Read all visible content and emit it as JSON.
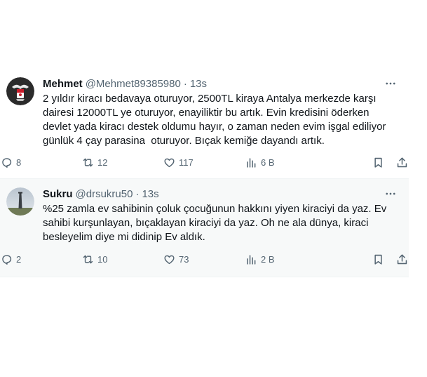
{
  "tweets": [
    {
      "name": "Mehmet",
      "handle": "@Mehmet89385980",
      "separator": "·",
      "time": "13s",
      "text": "2 yıldır kiracı bedavaya oturuyor, 2500TL kiraya Antalya merkezde karşı dairesi 12000TL ye oturuyor, enayiliktir bu artık. Evin kredisini öderken devlet yada kiracı destek oldumu hayır, o zaman neden evim işgal ediliyor günlük 4 çay parasina  oturuyor. Bıçak kemiğe dayandı artık.",
      "replies": "8",
      "retweets": "12",
      "likes": "117",
      "views": "6 B",
      "avatar_icon": "eagle-crest-icon"
    },
    {
      "name": "Sukru",
      "handle": "@drsukru50",
      "separator": "·",
      "time": "13s",
      "text": "%25 zamla ev sahibinin çoluk çocuğunun hakkını yiyen kiraciyi da yaz. Ev sahibi kurşunlayan, bıçaklayan kiraciyi da yaz. Oh ne ala dünya, kiraci besleyelim diye mi didinip Ev aldık.",
      "replies": "2",
      "retweets": "10",
      "likes": "73",
      "views": "2 B",
      "avatar_icon": "tower-photo-icon"
    }
  ],
  "colors": {
    "text": "#0f1419",
    "muted": "#536471",
    "highlight_bg": "#f7f9f9",
    "border": "#eff3f4"
  },
  "icons": [
    "reply-icon",
    "retweet-icon",
    "like-icon",
    "views-icon",
    "bookmark-icon",
    "share-icon",
    "more-icon"
  ]
}
